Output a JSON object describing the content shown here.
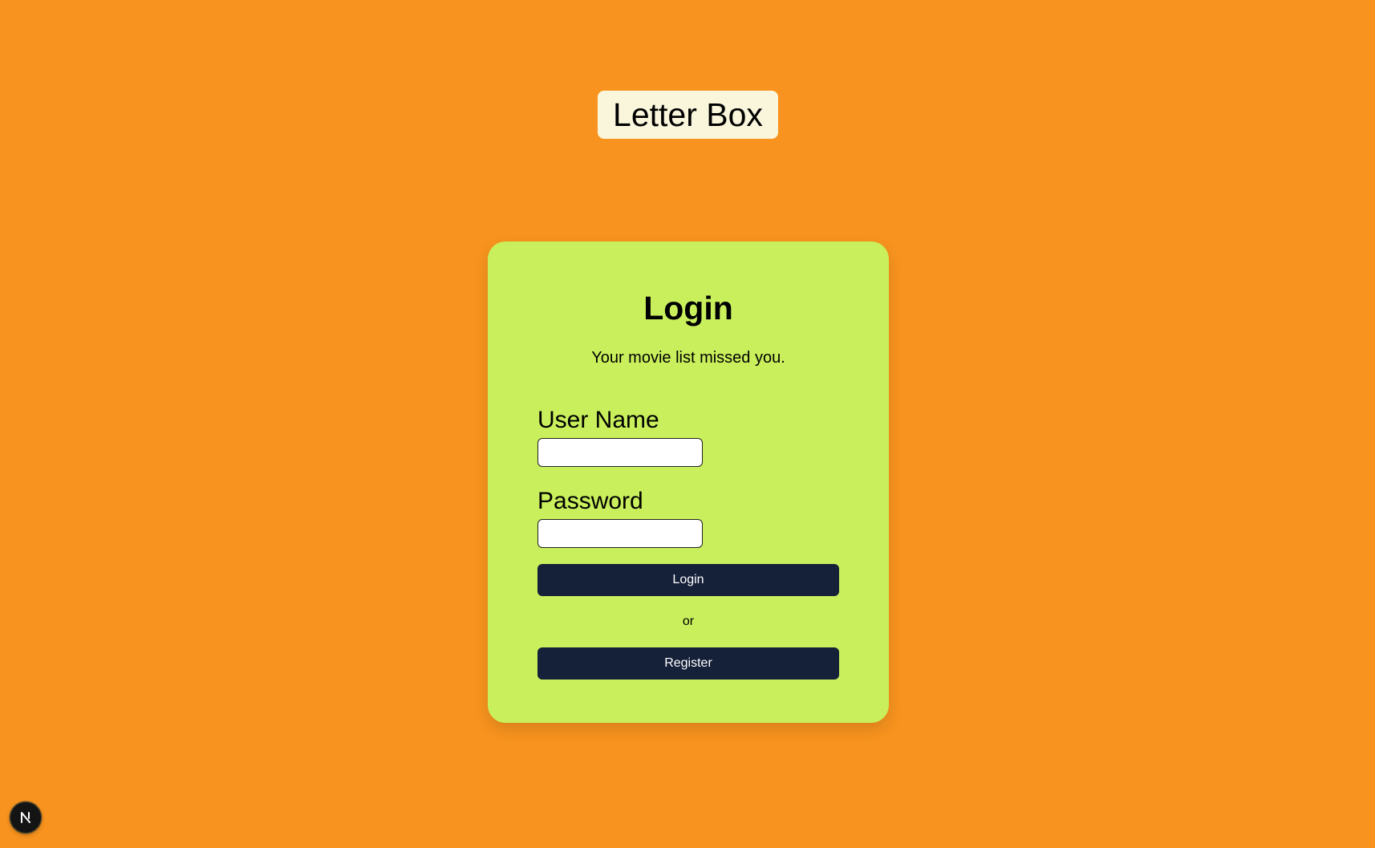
{
  "app": {
    "title": "Letter Box"
  },
  "login": {
    "title": "Login",
    "subtitle": "Your movie list missed you.",
    "username_label": "User Name",
    "username_value": "",
    "password_label": "Password",
    "password_value": "",
    "login_button": "Login",
    "separator": "or",
    "register_button": "Register"
  },
  "devtools": {
    "icon": "nextjs-icon"
  },
  "colors": {
    "page_background": "#f7931e",
    "brand_background": "#faf6dc",
    "card_background": "#c9f05c",
    "button_background": "#152039",
    "button_text": "#ffffff"
  }
}
